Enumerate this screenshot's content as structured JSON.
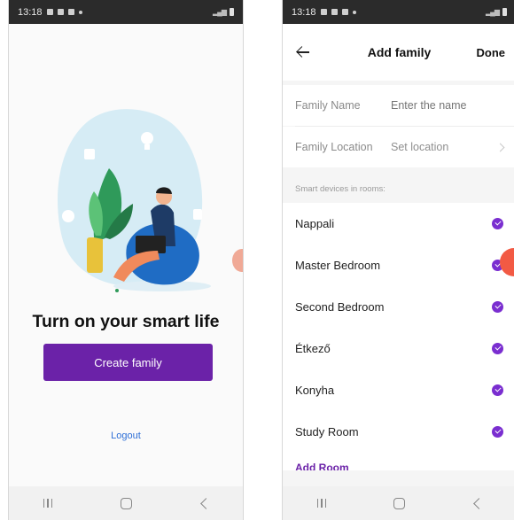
{
  "status_bar": {
    "time": "13:18"
  },
  "left_screen": {
    "headline": "Turn on your smart life",
    "create_button": "Create family",
    "logout": "Logout"
  },
  "right_screen": {
    "title": "Add family",
    "done": "Done",
    "family_name": {
      "label": "Family Name",
      "placeholder": "Enter the name",
      "value": ""
    },
    "family_location": {
      "label": "Family Location",
      "value": "Set location"
    },
    "rooms_caption": "Smart devices in rooms:",
    "rooms": [
      {
        "name": "Nappali",
        "checked": true
      },
      {
        "name": "Master Bedroom",
        "checked": true
      },
      {
        "name": "Second Bedroom",
        "checked": true
      },
      {
        "name": "Étkező",
        "checked": true
      },
      {
        "name": "Konyha",
        "checked": true
      },
      {
        "name": "Study Room",
        "checked": true
      }
    ],
    "add_room": "Add Room"
  },
  "colors": {
    "accent_purple": "#6b22a8",
    "check_purple": "#7a2ed0",
    "link_blue": "#2e6fd6",
    "fab_red": "#f25a44"
  },
  "icons": [
    "back-arrow-icon",
    "chevron-right-icon",
    "check-circle-icon",
    "nav-recent-icon",
    "nav-home-icon",
    "nav-back-icon"
  ]
}
